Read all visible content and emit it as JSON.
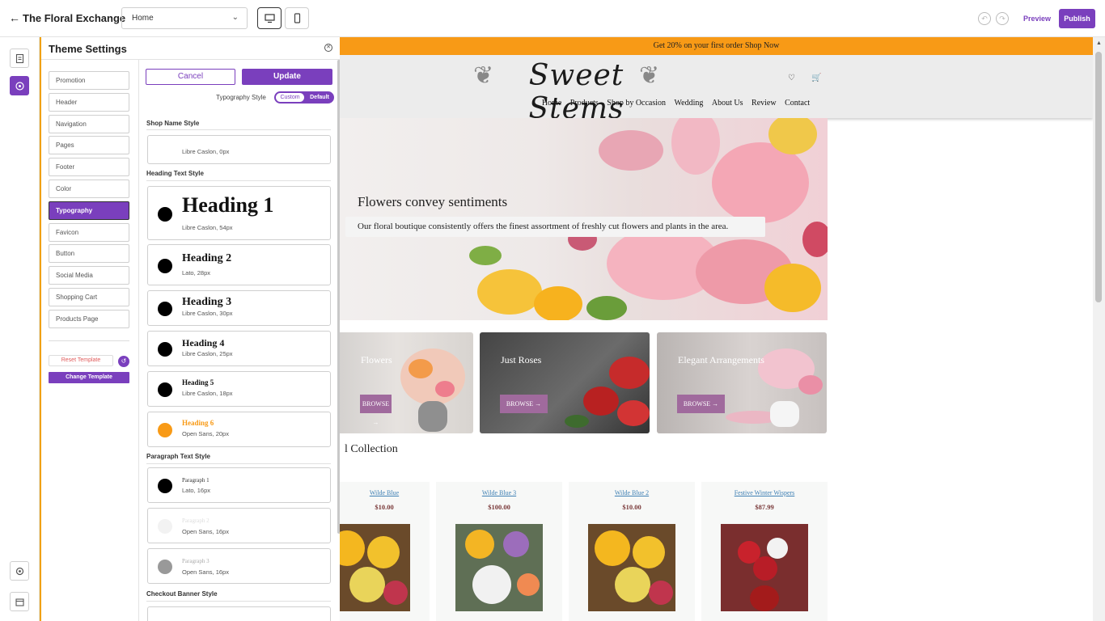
{
  "topbar": {
    "title": "The Floral Exchange",
    "page_select": "Home",
    "preview": "Preview",
    "publish": "Publish"
  },
  "settings": {
    "title": "Theme Settings",
    "menu": [
      "Promotion",
      "Header",
      "Navigation",
      "Pages",
      "Footer",
      "Color",
      "Typography",
      "Favicon",
      "Button",
      "Social Media",
      "Shopping Cart",
      "Products Page"
    ],
    "active_menu": "Typography",
    "reset_template": "Reset Template",
    "change_template": "Change Template",
    "cancel": "Cancel",
    "update": "Update",
    "typography_style_label": "Typography Style",
    "toggle_custom": "Custom",
    "toggle_default": "Default",
    "shop_name_section": "Shop Name Style",
    "shop_name_meta": "Libre Caslon, 0px",
    "heading_section": "Heading Text Style",
    "headings": [
      {
        "label": "Heading 1",
        "meta": "Libre Caslon, 54px",
        "color": "#000000"
      },
      {
        "label": "Heading 2",
        "meta": "Lato, 28px",
        "color": "#000000"
      },
      {
        "label": "Heading 3",
        "meta": "Libre Caslon, 30px",
        "color": "#000000"
      },
      {
        "label": "Heading 4",
        "meta": "Libre Caslon, 25px",
        "color": "#000000"
      },
      {
        "label": "Heading 5",
        "meta": "Libre Caslon, 18px",
        "color": "#000000"
      },
      {
        "label": "Heading 6",
        "meta": "Open Sans, 20px",
        "color": "#f89a16"
      }
    ],
    "paragraph_section": "Paragraph Text Style",
    "paragraphs": [
      {
        "label": "Paragraph 1",
        "meta": "Lato, 16px",
        "color": "#000000"
      },
      {
        "label": "Paragraph 2",
        "meta": "Open Sans, 16px",
        "color": "#f2f2f2"
      },
      {
        "label": "Paragraph 3",
        "meta": "Open Sans, 16px",
        "color": "#999999"
      }
    ],
    "checkout_section": "Checkout Banner Style"
  },
  "site": {
    "promo_text": "Get 20% on your first order  Shop Now",
    "logo": "Sweet Stems",
    "nav": [
      "Home",
      "Products",
      "Shop by Occasion",
      "Wedding",
      "About Us",
      "Review",
      "Contact"
    ],
    "hero_title": "Flowers convey sentiments",
    "hero_subtitle": "Our floral boutique consistently offers the finest assortment of freshly cut flowers and plants in the area.",
    "categories": [
      {
        "title": "Flowers",
        "button": "BROWSE  →"
      },
      {
        "title": "Just Roses",
        "button": "BROWSE  →"
      },
      {
        "title": "Elegant Arrangements",
        "button": "BROWSE  →"
      }
    ],
    "collection_title": "l Collection",
    "products": [
      {
        "name": "Wilde Blue",
        "price": "$10.00"
      },
      {
        "name": "Wilde Blue 3",
        "price": "$100.00"
      },
      {
        "name": "Wilde Blue 2",
        "price": "$10.00"
      },
      {
        "name": "Festive Winter Wispers",
        "price": "$87.99"
      }
    ]
  },
  "colors": {
    "accent": "#7a3fbd",
    "promo": "#f89a16",
    "browse": "#a06a9d"
  }
}
